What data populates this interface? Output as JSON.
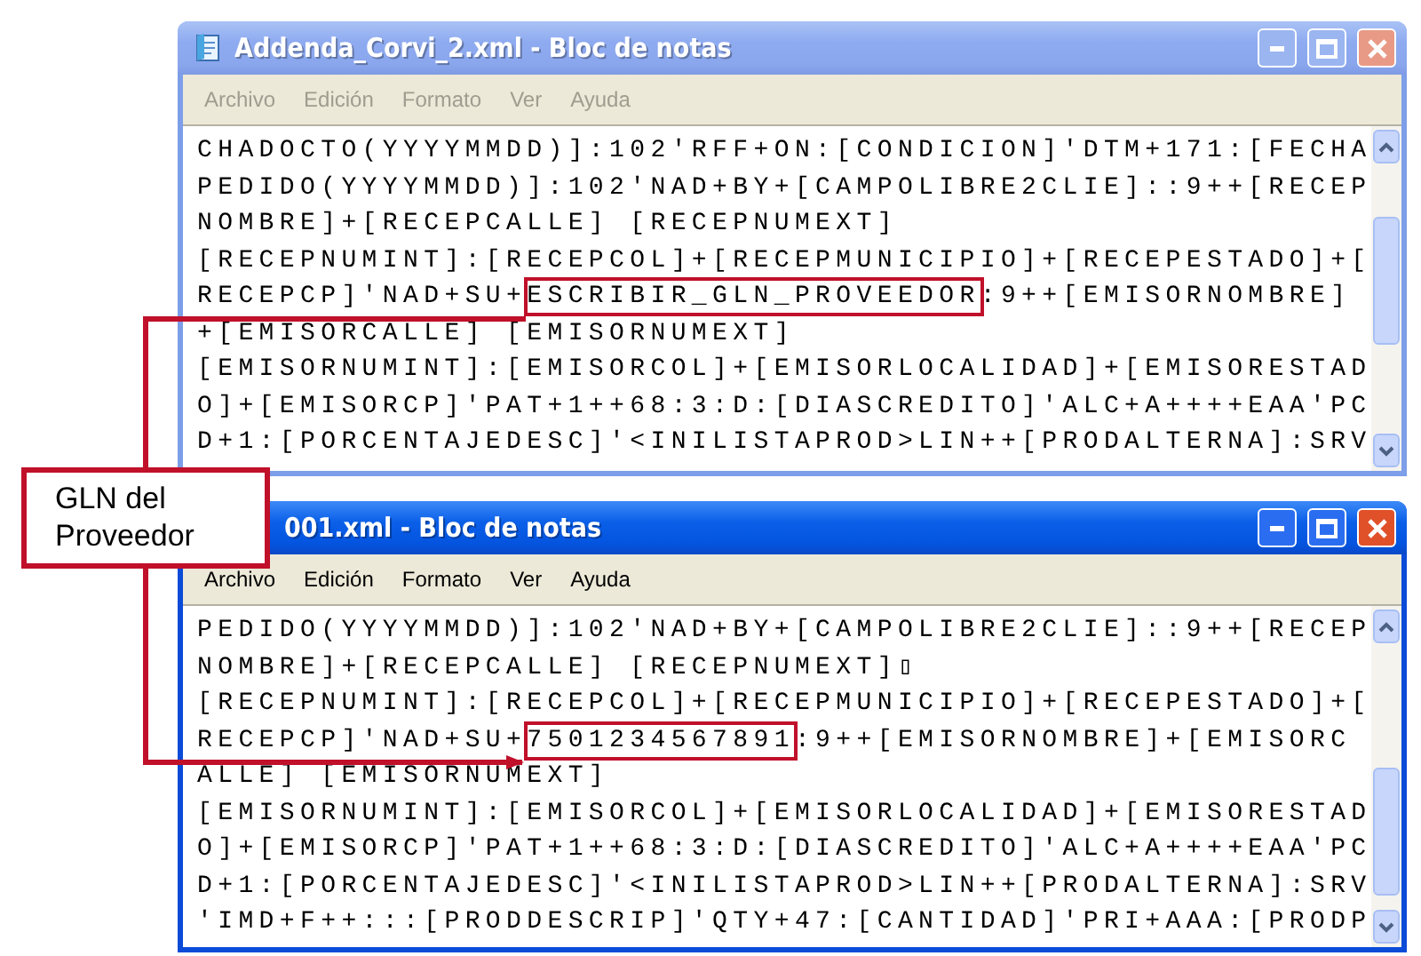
{
  "windows": [
    {
      "title": "Addenda_Corvi_2.xml - Bloc de notas",
      "active": false,
      "icon_visible": true,
      "menu": [
        "Archivo",
        "Edición",
        "Formato",
        "Ver",
        "Ayuda"
      ],
      "lines": [
        {
          "parts": [
            {
              "text": "CHADOCTO(YYYYMMDD)]:102'RFF+ON:[CONDICION]'DTM+171:[FECHA",
              "highlighted": false
            }
          ]
        },
        {
          "parts": [
            {
              "text": "PEDIDO(YYYYMMDD)]:102'NAD+BY+[CAMPOLIBRE2CLIE]::9++[RECEP",
              "highlighted": false
            }
          ]
        },
        {
          "parts": [
            {
              "text": "NOMBRE]+[RECEPCALLE] [RECEPNUMEXT]",
              "highlighted": false
            }
          ]
        },
        {
          "parts": [
            {
              "text": "[RECEPNUMINT]:[RECEPCOL]+[RECEPMUNICIPIO]+[RECEPESTADO]+[",
              "highlighted": false
            }
          ]
        },
        {
          "parts": [
            {
              "text": "RECEPCP]'NAD+SU+",
              "highlighted": false
            },
            {
              "text": "ESCRIBIR_GLN_PROVEEDOR",
              "highlighted": true
            },
            {
              "text": ":9++[EMISORNOMBRE]",
              "highlighted": false
            }
          ]
        },
        {
          "parts": [
            {
              "text": "+[EMISORCALLE] [EMISORNUMEXT]",
              "highlighted": false
            }
          ]
        },
        {
          "parts": [
            {
              "text": "[EMISORNUMINT]:[EMISORCOL]+[EMISORLOCALIDAD]+[EMISORESTAD",
              "highlighted": false
            }
          ]
        },
        {
          "parts": [
            {
              "text": "O]+[EMISORCP]'PAT+1++68:3:D:[DIASCREDITO]'ALC+A++++EAA'PC",
              "highlighted": false
            }
          ]
        },
        {
          "parts": [
            {
              "text": "D+1:[PORCENTAJEDESC]'<INILISTAPROD>LIN++[PRODALTERNA]:SRV",
              "highlighted": false
            }
          ]
        }
      ]
    },
    {
      "title": "001.xml - Bloc de notas",
      "active": true,
      "icon_visible": false,
      "menu": [
        "Archivo",
        "Edición",
        "Formato",
        "Ver",
        "Ayuda"
      ],
      "lines": [
        {
          "parts": [
            {
              "text": "PEDIDO(YYYYMMDD)]:102'NAD+BY+[CAMPOLIBRE2CLIE]::9++[RECEP",
              "highlighted": false
            }
          ]
        },
        {
          "parts": [
            {
              "text": "NOMBRE]+[RECEPCALLE] [RECEPNUMEXT]▯",
              "highlighted": false
            }
          ]
        },
        {
          "parts": [
            {
              "text": "[RECEPNUMINT]:[RECEPCOL]+[RECEPMUNICIPIO]+[RECEPESTADO]+[",
              "highlighted": false
            }
          ]
        },
        {
          "parts": [
            {
              "text": "RECEPCP]'NAD+SU+",
              "highlighted": false
            },
            {
              "text": "7501234567891",
              "highlighted": true
            },
            {
              "text": ":9++[EMISORNOMBRE]+[EMISORC",
              "highlighted": false
            }
          ]
        },
        {
          "parts": [
            {
              "text": "ALLE] [EMISORNUMEXT]",
              "highlighted": false
            }
          ]
        },
        {
          "parts": [
            {
              "text": "[EMISORNUMINT]:[EMISORCOL]+[EMISORLOCALIDAD]+[EMISORESTAD",
              "highlighted": false
            }
          ]
        },
        {
          "parts": [
            {
              "text": "O]+[EMISORCP]'PAT+1++68:3:D:[DIASCREDITO]'ALC+A++++EAA'PC",
              "highlighted": false
            }
          ]
        },
        {
          "parts": [
            {
              "text": "D+1:[PORCENTAJEDESC]'<INILISTAPROD>LIN++[PRODALTERNA]:SRV",
              "highlighted": false
            }
          ]
        },
        {
          "parts": [
            {
              "text": "'IMD+F++:::[PRODDESCRIP]'QTY+47:[CANTIDAD]'PRI+AAA:[PRODP",
              "highlighted": false
            }
          ]
        }
      ]
    }
  ],
  "callout": {
    "text": "GLN del Proveedor"
  }
}
